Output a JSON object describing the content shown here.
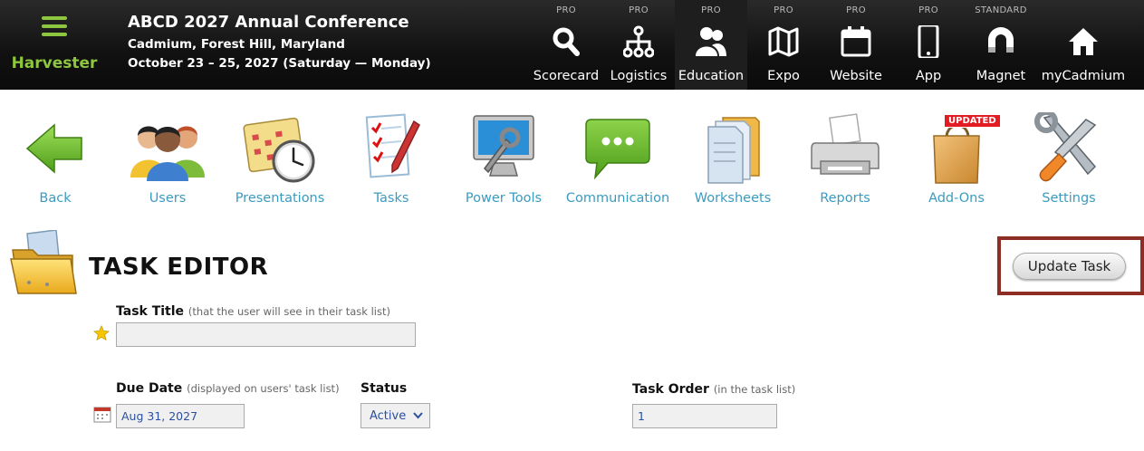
{
  "brand": {
    "name": "Harvester"
  },
  "conference": {
    "title": "ABCD 2027 Annual Conference",
    "location": "Cadmium, Forest Hill, Maryland",
    "dates": "October 23 – 25, 2027 (Saturday — Monday)"
  },
  "nav": {
    "items": [
      {
        "tier": "PRO",
        "label": "Scorecard",
        "icon": "search-icon"
      },
      {
        "tier": "PRO",
        "label": "Logistics",
        "icon": "network-icon"
      },
      {
        "tier": "PRO",
        "label": "Education",
        "icon": "people-icon",
        "active": true
      },
      {
        "tier": "PRO",
        "label": "Expo",
        "icon": "map-icon"
      },
      {
        "tier": "PRO",
        "label": "Website",
        "icon": "calendar-icon"
      },
      {
        "tier": "PRO",
        "label": "App",
        "icon": "phone-icon"
      },
      {
        "tier": "STANDARD",
        "label": "Magnet",
        "icon": "magnet-icon"
      },
      {
        "tier": "",
        "label": "myCadmium",
        "icon": "home-icon"
      }
    ]
  },
  "tools": {
    "items": [
      {
        "label": "Back",
        "icon": "back-arrow-icon"
      },
      {
        "label": "Users",
        "icon": "users-icon"
      },
      {
        "label": "Presentations",
        "icon": "calendar-clock-icon"
      },
      {
        "label": "Tasks",
        "icon": "checklist-icon"
      },
      {
        "label": "Power Tools",
        "icon": "monitor-wrench-icon"
      },
      {
        "label": "Communication",
        "icon": "chat-bubble-icon"
      },
      {
        "label": "Worksheets",
        "icon": "documents-icon"
      },
      {
        "label": "Reports",
        "icon": "printer-icon"
      },
      {
        "label": "Add-Ons",
        "icon": "shopping-bag-icon",
        "badge": "UPDATED"
      },
      {
        "label": "Settings",
        "icon": "tools-icon"
      }
    ]
  },
  "editor": {
    "title": "TASK EDITOR",
    "update_button": "Update Task",
    "task_title": {
      "label": "Task Title",
      "hint": "(that the user will see in their task list)",
      "value": ""
    },
    "due_date": {
      "label": "Due Date",
      "hint": "(displayed on users' task list)",
      "value": "Aug 31, 2027"
    },
    "status": {
      "label": "Status",
      "value": "Active"
    },
    "task_order": {
      "label": "Task Order",
      "hint": "(in the task list)",
      "value": "1"
    }
  },
  "colors": {
    "brand_green": "#8dc63f",
    "link_blue": "#3a9bbf",
    "highlight": "#8e2d24",
    "badge_red": "#e31b23"
  }
}
